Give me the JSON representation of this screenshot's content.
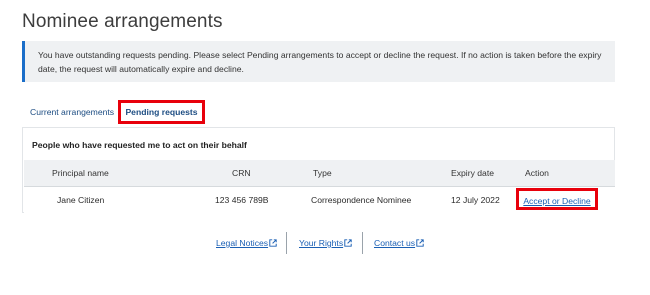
{
  "page": {
    "title": "Nominee arrangements"
  },
  "notice": {
    "text": "You have outstanding requests pending. Please select Pending arrangements to accept or decline the request. If no action is taken before the expiry date, the request will automatically expire and decline."
  },
  "tabs": [
    {
      "label": "Current arrangements",
      "active": false
    },
    {
      "label": "Pending requests",
      "active": true
    }
  ],
  "panel": {
    "heading": "People who have requested me to act on their behalf",
    "columns": [
      "Principal name",
      "CRN",
      "Type",
      "Expiry date",
      "Action"
    ],
    "rows": [
      {
        "principal_name": "Jane Citizen",
        "crn": "123 456 789B",
        "type": "Correspondence Nominee",
        "expiry_date": "12 July 2022",
        "action": "Accept or Decline"
      }
    ]
  },
  "footer": {
    "links": [
      {
        "label": "Legal Notices",
        "icon": "external-link-icon"
      },
      {
        "label": "Your Rights",
        "icon": "external-link-icon"
      },
      {
        "label": "Contact us",
        "icon": "external-link-icon"
      }
    ]
  },
  "colors": {
    "accent": "#1a6ec9",
    "link": "#1a5fb4",
    "highlight": "#e8000b",
    "notice_bg": "#eff1f3"
  }
}
